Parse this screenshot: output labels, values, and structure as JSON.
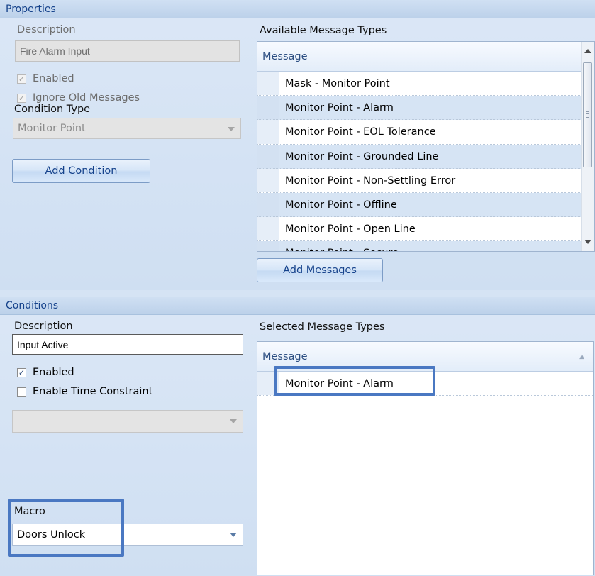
{
  "properties": {
    "title": "Properties",
    "description_label": "Description",
    "description_value": "Fire Alarm Input",
    "enabled_label": "Enabled",
    "enabled_checked": true,
    "ignore_old_label": "Ignore Old Messages",
    "ignore_old_checked": true,
    "condition_type_label": "Condition Type",
    "condition_type_value": "Monitor Point",
    "add_condition_label": "Add Condition",
    "available_label": "Available Message Types",
    "available_grid": {
      "header": "Message",
      "rows": [
        "Mask - Monitor Point",
        "Monitor Point - Alarm",
        "Monitor Point - EOL Tolerance",
        "Monitor Point - Grounded Line",
        "Monitor Point - Non-Settling Error",
        "Monitor Point - Offline",
        "Monitor Point - Open Line",
        "Monitor Point - Secure"
      ]
    },
    "add_messages_label": "Add Messages"
  },
  "conditions": {
    "title": "Conditions",
    "description_label": "Description",
    "description_value": "Input Active",
    "enabled_label": "Enabled",
    "enabled_checked": true,
    "time_constraint_label": "Enable Time Constraint",
    "time_constraint_checked": false,
    "time_constraint_value": "",
    "macro_label": "Macro",
    "macro_value": "Doors Unlock",
    "selected_label": "Selected Message Types",
    "selected_grid": {
      "header": "Message",
      "rows": [
        "Monitor Point - Alarm"
      ]
    }
  },
  "icons": {
    "check": "check-mark",
    "sort": "sort-ascending-icon",
    "dropdown": "chevron-down-icon"
  },
  "colors": {
    "panel_bg": "#d5e3f4",
    "title_text": "#15428b",
    "highlight": "#4a78c2",
    "alt_row": "#d6e4f4"
  }
}
